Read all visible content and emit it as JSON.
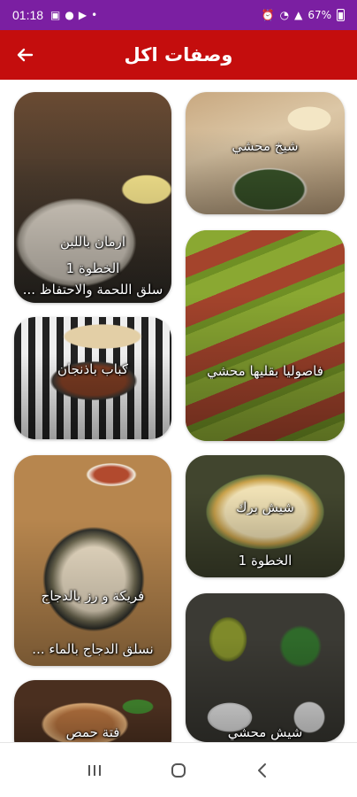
{
  "status_bar": {
    "time": "01:18",
    "battery": "67%"
  },
  "app_bar": {
    "title": "وصفات اكل"
  },
  "recipes": {
    "r1": {
      "title": "شيخ محشي"
    },
    "r2": {
      "title": "ارمان باللبن",
      "line2": "الخطوة 1",
      "line3": "سلق اللحمة والاحتفاظ ..."
    },
    "r3": {
      "title": "فاصوليا بقليها محشي"
    },
    "r4": {
      "title": "كباب باذنجان"
    },
    "r5": {
      "title": "شيش برك",
      "line2": "الخطوة 1"
    },
    "r6": {
      "title": "فريكة و رز بالدجاج",
      "line2": "نسلق الدجاج بالماء ..."
    },
    "r7": {
      "title": "شيش محشي"
    },
    "r8": {
      "title": "فتة حمص"
    }
  },
  "colors": {
    "status_bar": "#7b1fa2",
    "app_bar": "#c40d0d"
  }
}
